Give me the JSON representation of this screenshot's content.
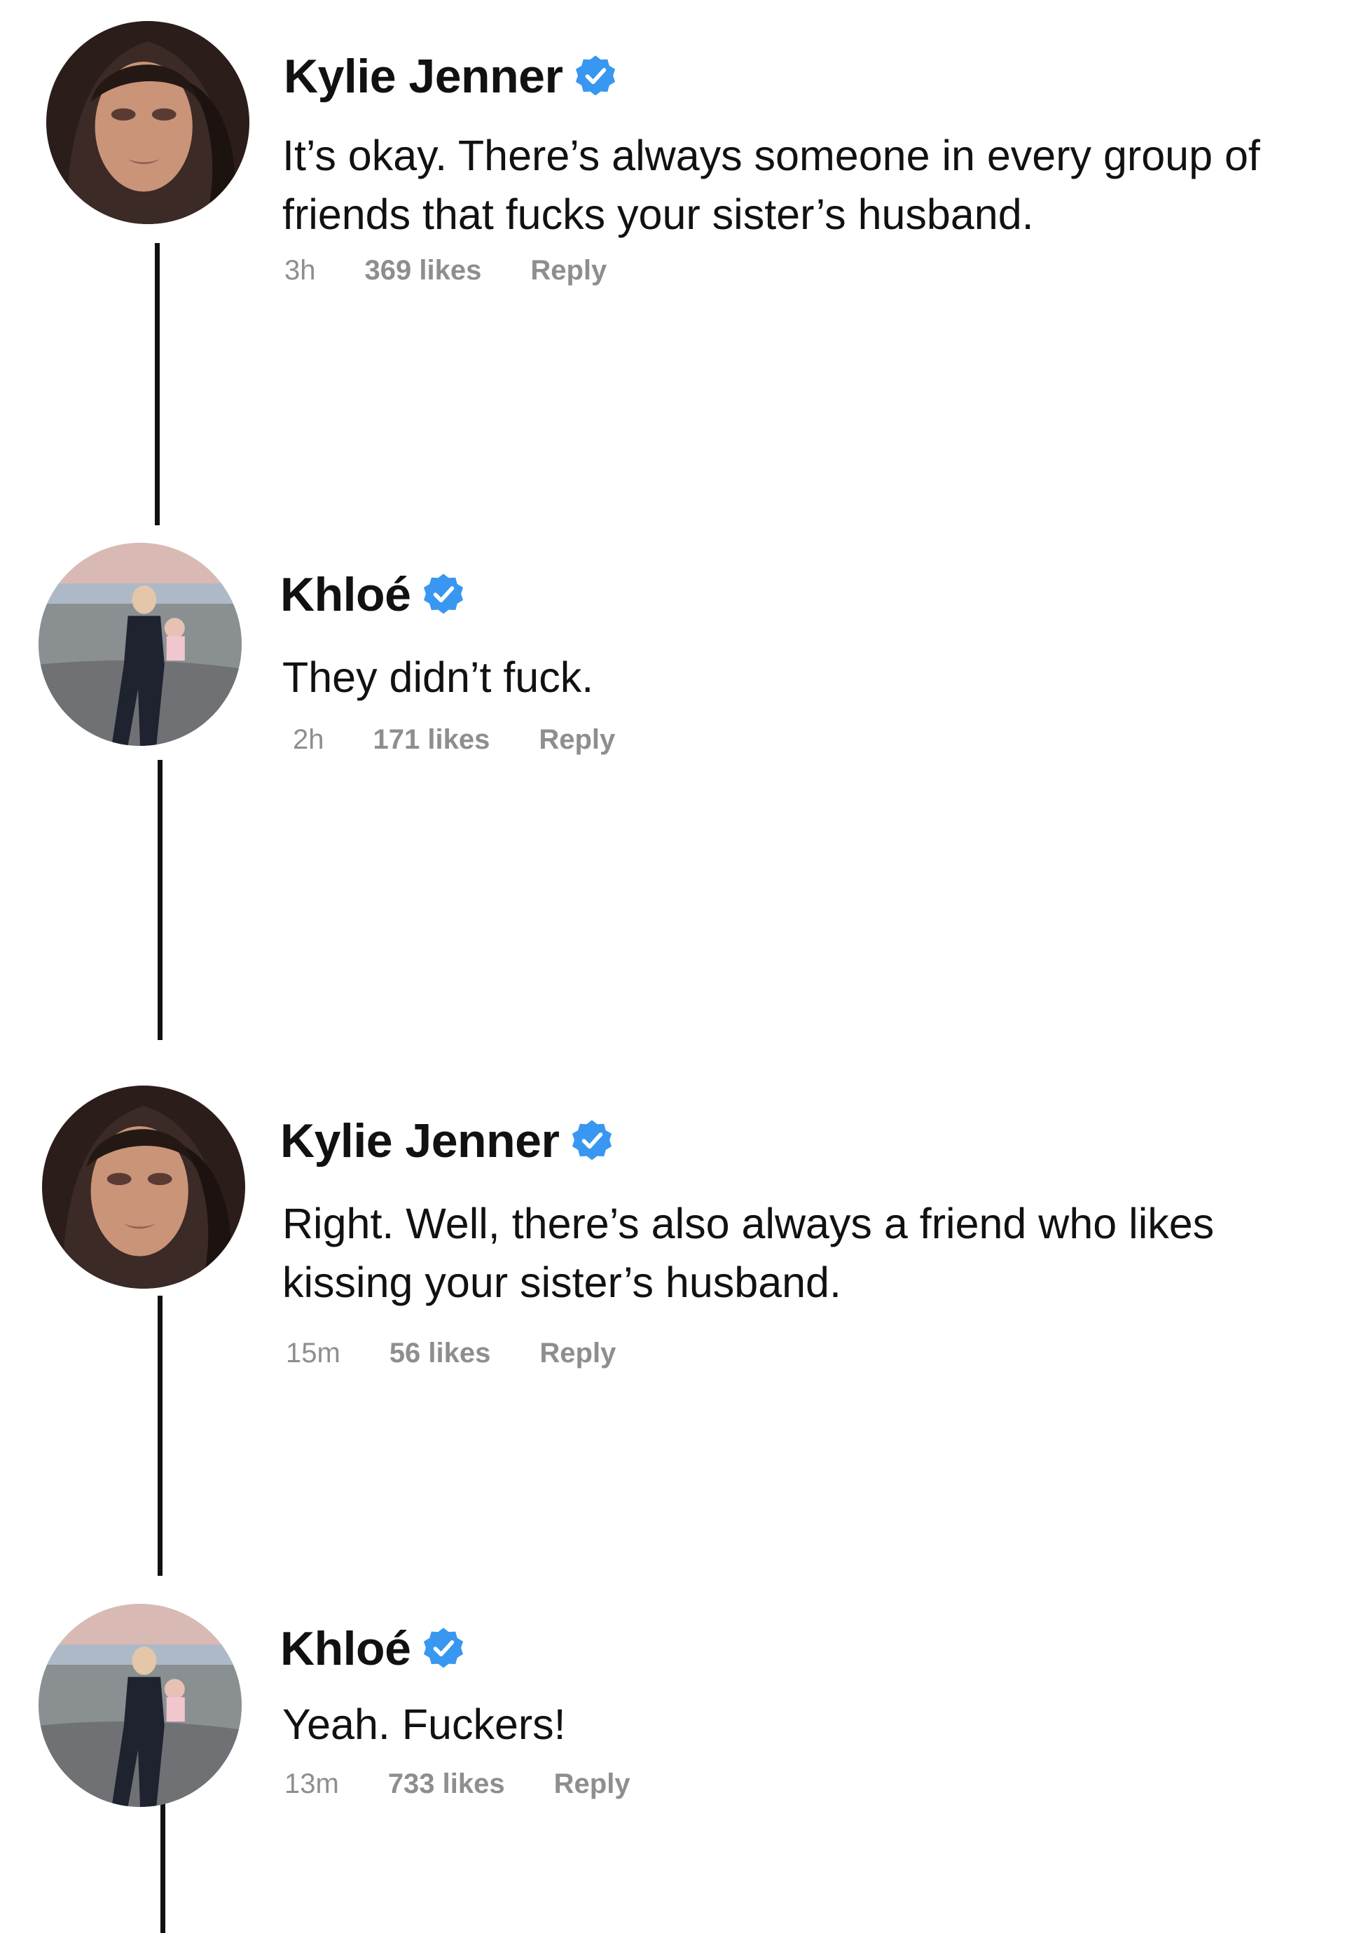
{
  "theme": {
    "text_color": "#111111",
    "meta_color": "#8e8e8e",
    "verified_color": "#3897f0",
    "thread_line_color": "#111111"
  },
  "comments": [
    {
      "username": "Kylie Jenner",
      "verified": true,
      "avatar": "kylie-portrait",
      "text": "It’s okay. There’s always someone in every group of friends that fucks your sister’s husband.",
      "time": "3h",
      "likes": "369 likes",
      "reply_label": "Reply"
    },
    {
      "username": "Khloé",
      "verified": true,
      "avatar": "khloe-beach-photo",
      "text": "They didn’t fuck.",
      "time": "2h",
      "likes": "171 likes",
      "reply_label": "Reply"
    },
    {
      "username": "Kylie Jenner",
      "verified": true,
      "avatar": "kylie-portrait",
      "text": "Right. Well, there’s also always a friend who likes kissing your sister’s husband.",
      "time": "15m",
      "likes": "56 likes",
      "reply_label": "Reply"
    },
    {
      "username": "Khloé",
      "verified": true,
      "avatar": "khloe-beach-photo",
      "text": "Yeah. Fuckers!",
      "time": "13m",
      "likes": "733 likes",
      "reply_label": "Reply"
    }
  ]
}
